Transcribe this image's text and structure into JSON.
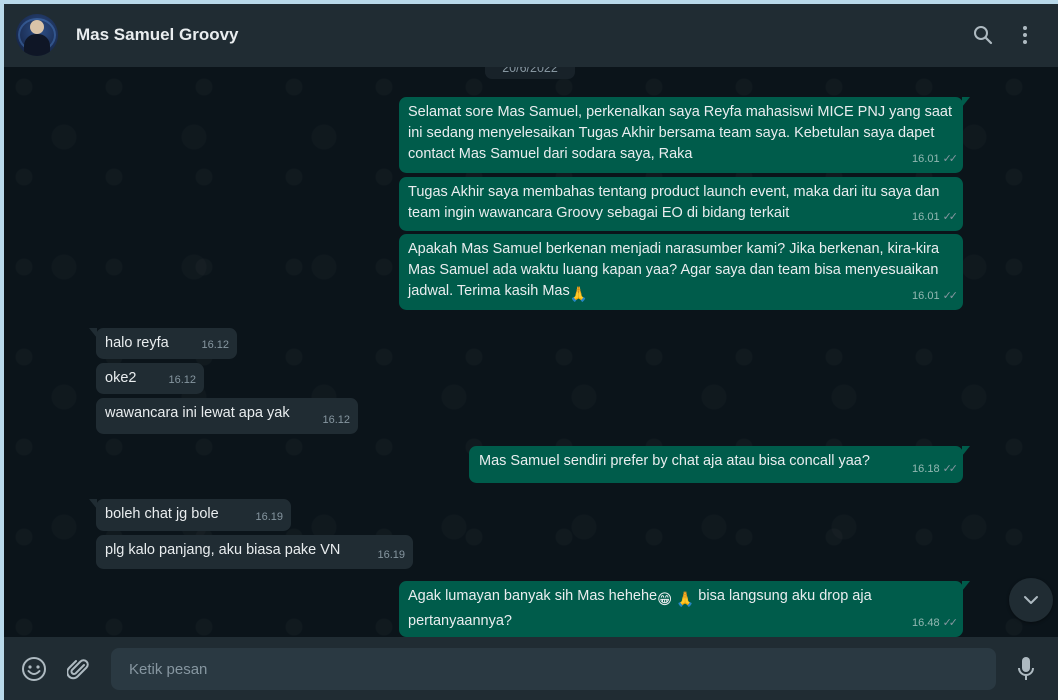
{
  "header": {
    "contact_name": "Mas Samuel Groovy",
    "icons": [
      "search-icon",
      "menu-dots-icon"
    ]
  },
  "chat": {
    "date_chip": "20/6/2022",
    "messages": [
      {
        "dir": "out",
        "text": "Selamat sore Mas Samuel, perkenalkan saya Reyfa mahasiswi MICE PNJ yang saat ini sedang menyelesaikan Tugas Akhir bersama team saya. Kebetulan saya dapet contact Mas Samuel dari sodara saya, Raka",
        "time": "16.01",
        "status": "read"
      },
      {
        "dir": "out",
        "text": "Tugas Akhir saya membahas tentang product launch event, maka dari itu saya dan team ingin wawancara Groovy sebagai EO di bidang terkait",
        "time": "16.01",
        "status": "read"
      },
      {
        "dir": "out",
        "text": "Apakah Mas Samuel berkenan menjadi narasumber kami? Jika berkenan, kira-kira Mas Samuel ada waktu luang kapan yaa? Agar saya dan team bisa menyesuaikan jadwal. Terima kasih Mas",
        "emoji_after": "🙏",
        "time": "16.01",
        "status": "read"
      },
      {
        "dir": "in",
        "text": "halo reyfa",
        "time": "16.12"
      },
      {
        "dir": "in",
        "text": "oke2",
        "time": "16.12"
      },
      {
        "dir": "in",
        "text": "wawancara ini lewat apa yak",
        "time": "16.12"
      },
      {
        "dir": "out",
        "text": "Mas Samuel sendiri prefer by chat aja atau bisa concall yaa?",
        "time": "16.18",
        "status": "read"
      },
      {
        "dir": "in",
        "text": "boleh chat jg bole",
        "time": "16.19"
      },
      {
        "dir": "in",
        "text": "plg kalo panjang, aku biasa pake VN",
        "time": "16.19"
      },
      {
        "dir": "out",
        "text_a": "Agak lumayan banyak sih Mas hehehe",
        "emojis": "😁 🙏",
        "text_b": " bisa langsung aku drop aja pertanyaannya?",
        "time": "16.48",
        "status": "read"
      }
    ]
  },
  "footer": {
    "input_placeholder": "Ketik pesan",
    "icons": [
      "emoji-icon",
      "attach-icon",
      "mic-icon"
    ]
  },
  "colors": {
    "outgoing_bubble": "#005c4b",
    "incoming_bubble": "#202c33",
    "chat_background": "#0b141a",
    "header_background": "#202c33"
  }
}
